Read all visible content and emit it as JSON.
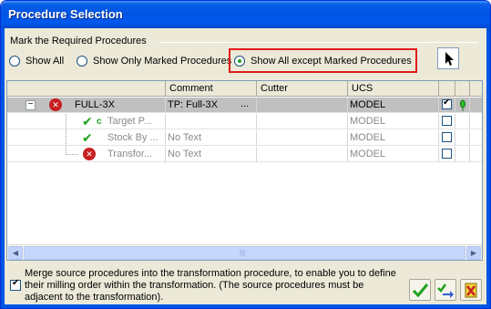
{
  "window": {
    "title": "Procedure Selection"
  },
  "group": {
    "label": "Mark the Required Procedures"
  },
  "radios": [
    {
      "label": "Show All",
      "selected": false
    },
    {
      "label": "Show Only Marked Procedures",
      "selected": false
    },
    {
      "label": "Show All except Marked Procedures",
      "selected": true
    }
  ],
  "columns": [
    "Comment",
    "Cutter",
    "UCS"
  ],
  "rows": [
    {
      "expander": "−",
      "status": "error",
      "name": "FULL-3X",
      "comment": "TP: Full-3X",
      "comment_more": "...",
      "cutter": "",
      "ucs": "MODEL",
      "checked": true,
      "has_pin": true
    },
    {
      "status": "ok",
      "status_extra": "c",
      "name": "Target P...",
      "comment": "",
      "cutter": "",
      "ucs": "MODEL",
      "checked": false
    },
    {
      "status": "ok",
      "name": "Stock By ...",
      "comment": "No Text",
      "cutter": "",
      "ucs": "MODEL",
      "checked": false
    },
    {
      "status": "error",
      "name": "Transfor...",
      "comment": "No Text",
      "cutter": "",
      "ucs": "MODEL",
      "checked": false
    }
  ],
  "scrollbar": {
    "grip": "|||"
  },
  "footer": {
    "merge_text": "Merge source procedures into the transformation procedure, to enable you to define their milling order within the transformation. (The source procedures must be adjacent to the transformation).",
    "merge_checked": true
  },
  "icons": {
    "ok": "check-icon",
    "apply": "apply-arrow-icon",
    "cancel": "cancel-icon"
  },
  "colors": {
    "highlight": "#e21b1b",
    "selected_row": "#c0c0c0",
    "title_bar": "#0054e3"
  }
}
